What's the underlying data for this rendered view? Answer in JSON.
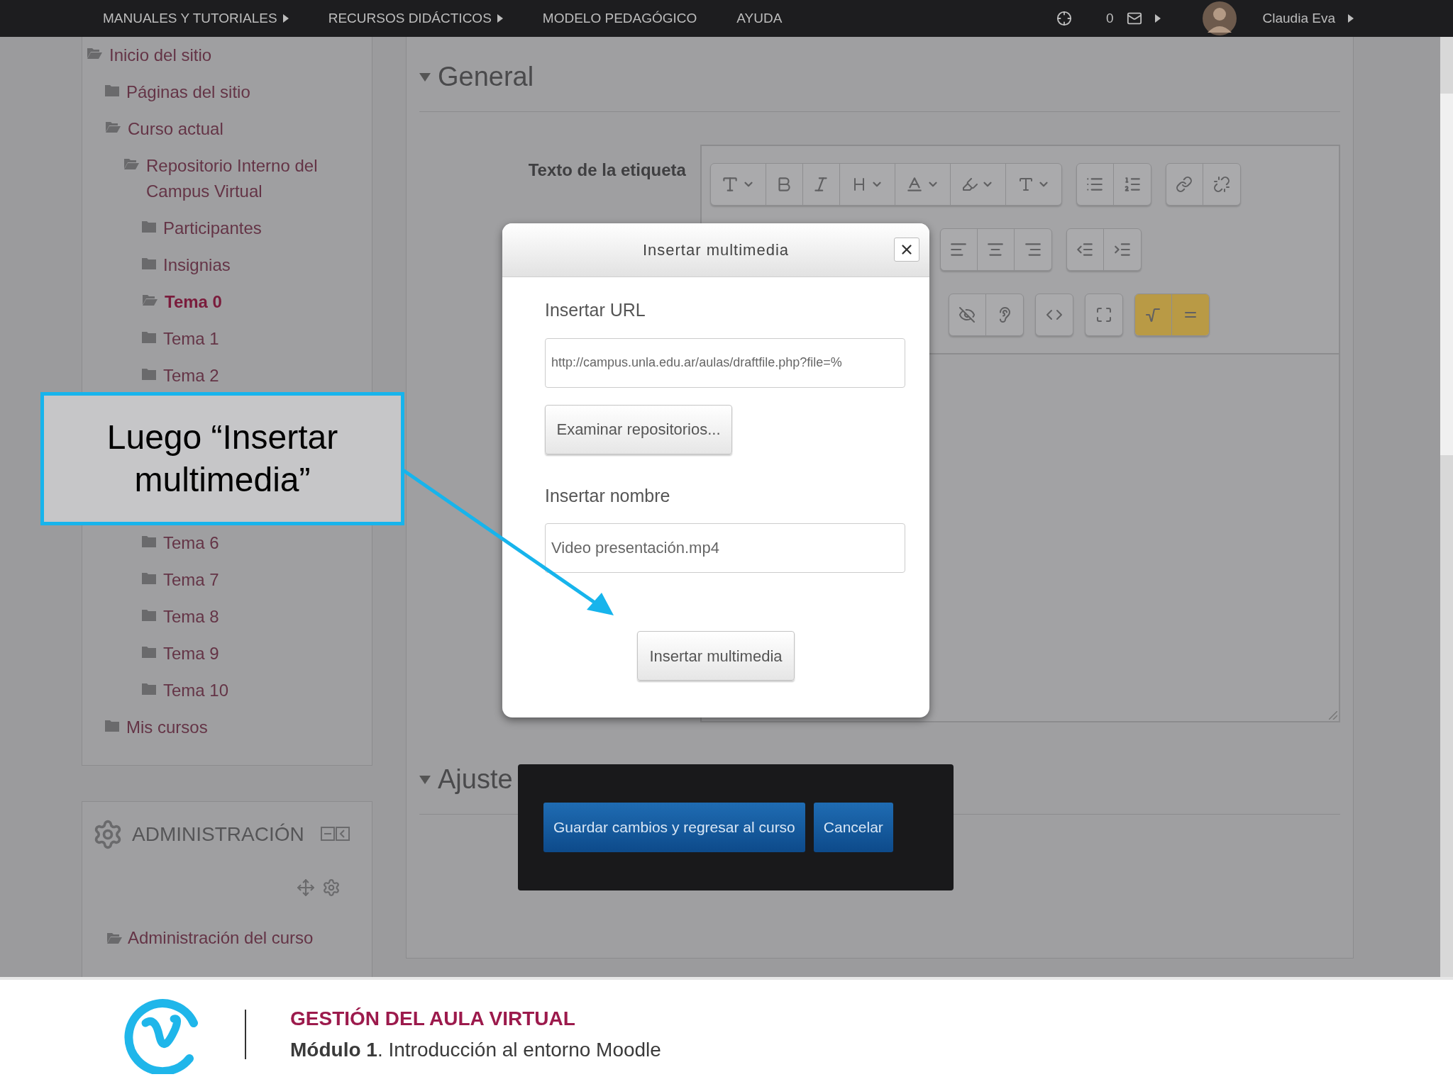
{
  "top_nav": {
    "items": [
      {
        "label": "MANUALES Y TUTORIALES",
        "has_menu": true
      },
      {
        "label": "RECURSOS DIDÁCTICOS",
        "has_menu": true
      },
      {
        "label": "MODELO PEDAGÓGICO",
        "has_menu": false
      },
      {
        "label": "AYUDA",
        "has_menu": false
      }
    ],
    "message_count": "0",
    "user": "Claudia Eva"
  },
  "navigation": {
    "items": [
      {
        "label": "Inicio del sitio",
        "expanded": true,
        "selected": false,
        "children": [
          {
            "label": "Páginas del sitio",
            "expanded": false,
            "selected": false
          },
          {
            "label": "Curso actual",
            "expanded": true,
            "selected": false,
            "children": [
              {
                "label": "Repositorio Interno del Campus Virtual",
                "expanded": true,
                "selected": false,
                "children": [
                  {
                    "label": "Participantes",
                    "expanded": false,
                    "selected": false
                  },
                  {
                    "label": "Insignias",
                    "expanded": false,
                    "selected": false
                  },
                  {
                    "label": "Tema 0",
                    "expanded": true,
                    "selected": true
                  },
                  {
                    "label": "Tema 1",
                    "expanded": false,
                    "selected": false
                  },
                  {
                    "label": "Tema 2",
                    "expanded": false,
                    "selected": false
                  },
                  {
                    "label": "Tema 6",
                    "expanded": false,
                    "selected": false
                  },
                  {
                    "label": "Tema 7",
                    "expanded": false,
                    "selected": false
                  },
                  {
                    "label": "Tema 8",
                    "expanded": false,
                    "selected": false
                  },
                  {
                    "label": "Tema 9",
                    "expanded": false,
                    "selected": false
                  },
                  {
                    "label": "Tema 10",
                    "expanded": false,
                    "selected": false
                  }
                ]
              }
            ]
          },
          {
            "label": "Mis cursos",
            "expanded": false,
            "selected": false
          }
        ]
      }
    ]
  },
  "administration": {
    "title": "ADMINISTRACIÓN",
    "items": [
      {
        "label": "Administración del curso",
        "expanded": true
      }
    ]
  },
  "form": {
    "general_title": "General",
    "field_label": "Texto de la etiqueta",
    "settings_title": "Ajuste"
  },
  "dialog": {
    "title": "Insertar multimedia",
    "url_label": "Insertar URL",
    "url_value": "http://campus.unla.edu.ar/aulas/draftfile.php?file=%",
    "browse_button": "Examinar repositorios...",
    "name_label": "Insertar nombre",
    "name_value": "Video presentación.mp4",
    "submit_button": "Insertar multimedia"
  },
  "action_bar": {
    "buttons": [
      "Guardar cambios y regresar al curso",
      "Cancelar"
    ]
  },
  "callout": {
    "text": "Luego “Insertar multimedia”"
  },
  "footer": {
    "title": "GESTIÓN DEL AULA VIRTUAL",
    "subtitle": "**Módulo 1**. Introducción al entorno Moodle"
  }
}
